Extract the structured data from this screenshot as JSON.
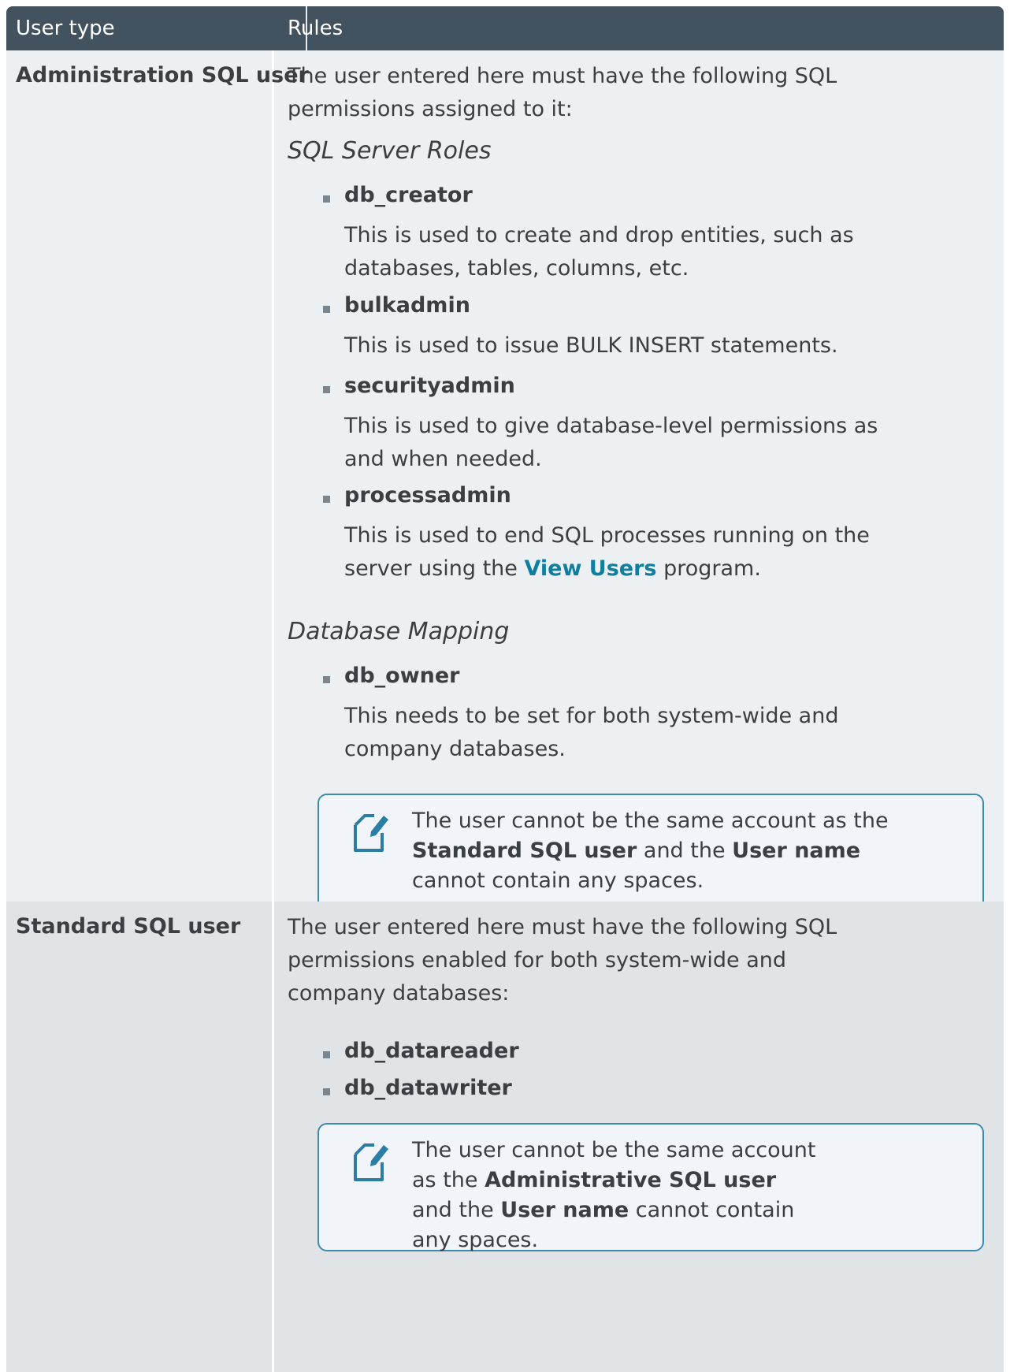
{
  "header": {
    "col1": "User type",
    "col2": "Rules"
  },
  "rows": [
    {
      "user_type": "Administration SQL user",
      "intro": "The user entered here must have the following SQL permissions assigned to it:",
      "section1_title": "SQL Server Roles",
      "roles": [
        {
          "name": "db_creator",
          "desc": "This is used to create and drop entities, such as databases, tables, columns, etc."
        },
        {
          "name": "bulkadmin",
          "desc": "This is used to issue BULK INSERT statements."
        },
        {
          "name": "securityadmin",
          "desc": "This is used to give database-level permissions as and when needed."
        },
        {
          "name": "processadmin",
          "desc_before": "This is used to end SQL processes running on the server using the ",
          "desc_link": "View Users",
          "desc_after": " program."
        }
      ],
      "section2_title": "Database Mapping",
      "mapping": [
        {
          "name": "db_owner",
          "desc": "This needs to be set for both system-wide and company databases."
        }
      ],
      "note": {
        "p1": "The user cannot be the same account as the ",
        "b1": "Standard SQL user",
        "p2": " and the ",
        "b2": "User name",
        "p3": " cannot contain any spaces."
      }
    },
    {
      "user_type": "Standard SQL user",
      "intro": "The user entered here must have the following SQL permissions enabled for both system-wide and company databases:",
      "perms": [
        "db_datareader",
        "db_datawriter"
      ],
      "note": {
        "p1": "The user cannot be the same account as the ",
        "b1": "Administrative SQL user",
        "p2": " and the ",
        "b2": "User name",
        "p3": " cannot contain any spaces."
      }
    }
  ],
  "icons": {
    "note": "note-edit-icon",
    "bullet": "square-bullet-icon"
  },
  "colors": {
    "header_bg": "#43525f",
    "row1_bg": "#edf0f2",
    "row2_bg": "#e1e4e7",
    "link": "#0f7fa0",
    "note_border": "#3d8bb0"
  }
}
